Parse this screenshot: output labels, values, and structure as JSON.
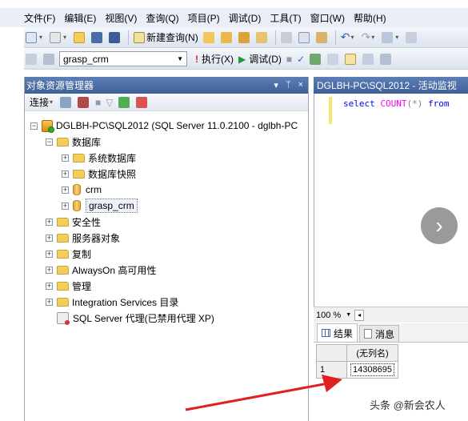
{
  "menu": [
    "文件(F)",
    "编辑(E)",
    "视图(V)",
    "查询(Q)",
    "项目(P)",
    "调试(D)",
    "工具(T)",
    "窗口(W)",
    "帮助(H)"
  ],
  "toolbar1": {
    "new_query": "新建查询(N)"
  },
  "toolbar2": {
    "database": "grasp_crm",
    "execute": "执行(X)",
    "debug": "调试(D)"
  },
  "object_explorer": {
    "title": "对象资源管理器",
    "pin": "ᛘ",
    "close": "×",
    "connect": "连接",
    "server": "DGLBH-PC\\SQL2012 (SQL Server 11.0.2100 - dglbh-PC",
    "databases": "数据库",
    "system_databases": "系统数据库",
    "database_snapshots": "数据库快照",
    "db1": "crm",
    "db2": "grasp_crm",
    "security": "安全性",
    "server_objects": "服务器对象",
    "replication": "复制",
    "alwayson": "AlwaysOn 高可用性",
    "management": "管理",
    "integration": "Integration Services 目录",
    "agent": "SQL Server 代理(已禁用代理 XP)"
  },
  "editor": {
    "tab_title": "DGLBH-PC\\SQL2012 - 活动监视",
    "kw_select": "select",
    "fn_count": "COUNT",
    "paren_open": "(",
    "star": "*",
    "paren_close": ")",
    "kw_from": "from"
  },
  "results": {
    "zoom": "100 %",
    "tab_results": "结果",
    "tab_messages": "消息",
    "column": "(无列名)",
    "row_number": "1",
    "value": "14308695"
  },
  "watermark": "头条 @新会农人",
  "colors": {
    "panel_title": "#4a6ca6",
    "arrow": "#e02020",
    "editor_marker": "#f6e66d"
  }
}
